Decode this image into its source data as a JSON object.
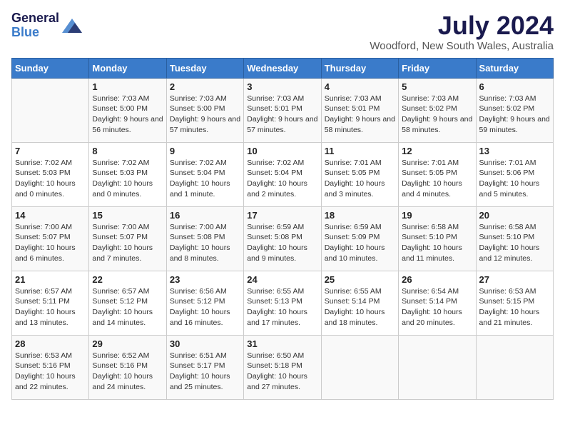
{
  "logo": {
    "general": "General",
    "blue": "Blue"
  },
  "title": {
    "month_year": "July 2024",
    "location": "Woodford, New South Wales, Australia"
  },
  "headers": [
    "Sunday",
    "Monday",
    "Tuesday",
    "Wednesday",
    "Thursday",
    "Friday",
    "Saturday"
  ],
  "weeks": [
    [
      {
        "day": "",
        "sunrise": "",
        "sunset": "",
        "daylight": ""
      },
      {
        "day": "1",
        "sunrise": "Sunrise: 7:03 AM",
        "sunset": "Sunset: 5:00 PM",
        "daylight": "Daylight: 9 hours and 56 minutes."
      },
      {
        "day": "2",
        "sunrise": "Sunrise: 7:03 AM",
        "sunset": "Sunset: 5:00 PM",
        "daylight": "Daylight: 9 hours and 57 minutes."
      },
      {
        "day": "3",
        "sunrise": "Sunrise: 7:03 AM",
        "sunset": "Sunset: 5:01 PM",
        "daylight": "Daylight: 9 hours and 57 minutes."
      },
      {
        "day": "4",
        "sunrise": "Sunrise: 7:03 AM",
        "sunset": "Sunset: 5:01 PM",
        "daylight": "Daylight: 9 hours and 58 minutes."
      },
      {
        "day": "5",
        "sunrise": "Sunrise: 7:03 AM",
        "sunset": "Sunset: 5:02 PM",
        "daylight": "Daylight: 9 hours and 58 minutes."
      },
      {
        "day": "6",
        "sunrise": "Sunrise: 7:03 AM",
        "sunset": "Sunset: 5:02 PM",
        "daylight": "Daylight: 9 hours and 59 minutes."
      }
    ],
    [
      {
        "day": "7",
        "sunrise": "Sunrise: 7:02 AM",
        "sunset": "Sunset: 5:03 PM",
        "daylight": "Daylight: 10 hours and 0 minutes."
      },
      {
        "day": "8",
        "sunrise": "Sunrise: 7:02 AM",
        "sunset": "Sunset: 5:03 PM",
        "daylight": "Daylight: 10 hours and 0 minutes."
      },
      {
        "day": "9",
        "sunrise": "Sunrise: 7:02 AM",
        "sunset": "Sunset: 5:04 PM",
        "daylight": "Daylight: 10 hours and 1 minute."
      },
      {
        "day": "10",
        "sunrise": "Sunrise: 7:02 AM",
        "sunset": "Sunset: 5:04 PM",
        "daylight": "Daylight: 10 hours and 2 minutes."
      },
      {
        "day": "11",
        "sunrise": "Sunrise: 7:01 AM",
        "sunset": "Sunset: 5:05 PM",
        "daylight": "Daylight: 10 hours and 3 minutes."
      },
      {
        "day": "12",
        "sunrise": "Sunrise: 7:01 AM",
        "sunset": "Sunset: 5:05 PM",
        "daylight": "Daylight: 10 hours and 4 minutes."
      },
      {
        "day": "13",
        "sunrise": "Sunrise: 7:01 AM",
        "sunset": "Sunset: 5:06 PM",
        "daylight": "Daylight: 10 hours and 5 minutes."
      }
    ],
    [
      {
        "day": "14",
        "sunrise": "Sunrise: 7:00 AM",
        "sunset": "Sunset: 5:07 PM",
        "daylight": "Daylight: 10 hours and 6 minutes."
      },
      {
        "day": "15",
        "sunrise": "Sunrise: 7:00 AM",
        "sunset": "Sunset: 5:07 PM",
        "daylight": "Daylight: 10 hours and 7 minutes."
      },
      {
        "day": "16",
        "sunrise": "Sunrise: 7:00 AM",
        "sunset": "Sunset: 5:08 PM",
        "daylight": "Daylight: 10 hours and 8 minutes."
      },
      {
        "day": "17",
        "sunrise": "Sunrise: 6:59 AM",
        "sunset": "Sunset: 5:08 PM",
        "daylight": "Daylight: 10 hours and 9 minutes."
      },
      {
        "day": "18",
        "sunrise": "Sunrise: 6:59 AM",
        "sunset": "Sunset: 5:09 PM",
        "daylight": "Daylight: 10 hours and 10 minutes."
      },
      {
        "day": "19",
        "sunrise": "Sunrise: 6:58 AM",
        "sunset": "Sunset: 5:10 PM",
        "daylight": "Daylight: 10 hours and 11 minutes."
      },
      {
        "day": "20",
        "sunrise": "Sunrise: 6:58 AM",
        "sunset": "Sunset: 5:10 PM",
        "daylight": "Daylight: 10 hours and 12 minutes."
      }
    ],
    [
      {
        "day": "21",
        "sunrise": "Sunrise: 6:57 AM",
        "sunset": "Sunset: 5:11 PM",
        "daylight": "Daylight: 10 hours and 13 minutes."
      },
      {
        "day": "22",
        "sunrise": "Sunrise: 6:57 AM",
        "sunset": "Sunset: 5:12 PM",
        "daylight": "Daylight: 10 hours and 14 minutes."
      },
      {
        "day": "23",
        "sunrise": "Sunrise: 6:56 AM",
        "sunset": "Sunset: 5:12 PM",
        "daylight": "Daylight: 10 hours and 16 minutes."
      },
      {
        "day": "24",
        "sunrise": "Sunrise: 6:55 AM",
        "sunset": "Sunset: 5:13 PM",
        "daylight": "Daylight: 10 hours and 17 minutes."
      },
      {
        "day": "25",
        "sunrise": "Sunrise: 6:55 AM",
        "sunset": "Sunset: 5:14 PM",
        "daylight": "Daylight: 10 hours and 18 minutes."
      },
      {
        "day": "26",
        "sunrise": "Sunrise: 6:54 AM",
        "sunset": "Sunset: 5:14 PM",
        "daylight": "Daylight: 10 hours and 20 minutes."
      },
      {
        "day": "27",
        "sunrise": "Sunrise: 6:53 AM",
        "sunset": "Sunset: 5:15 PM",
        "daylight": "Daylight: 10 hours and 21 minutes."
      }
    ],
    [
      {
        "day": "28",
        "sunrise": "Sunrise: 6:53 AM",
        "sunset": "Sunset: 5:16 PM",
        "daylight": "Daylight: 10 hours and 22 minutes."
      },
      {
        "day": "29",
        "sunrise": "Sunrise: 6:52 AM",
        "sunset": "Sunset: 5:16 PM",
        "daylight": "Daylight: 10 hours and 24 minutes."
      },
      {
        "day": "30",
        "sunrise": "Sunrise: 6:51 AM",
        "sunset": "Sunset: 5:17 PM",
        "daylight": "Daylight: 10 hours and 25 minutes."
      },
      {
        "day": "31",
        "sunrise": "Sunrise: 6:50 AM",
        "sunset": "Sunset: 5:18 PM",
        "daylight": "Daylight: 10 hours and 27 minutes."
      },
      {
        "day": "",
        "sunrise": "",
        "sunset": "",
        "daylight": ""
      },
      {
        "day": "",
        "sunrise": "",
        "sunset": "",
        "daylight": ""
      },
      {
        "day": "",
        "sunrise": "",
        "sunset": "",
        "daylight": ""
      }
    ]
  ]
}
